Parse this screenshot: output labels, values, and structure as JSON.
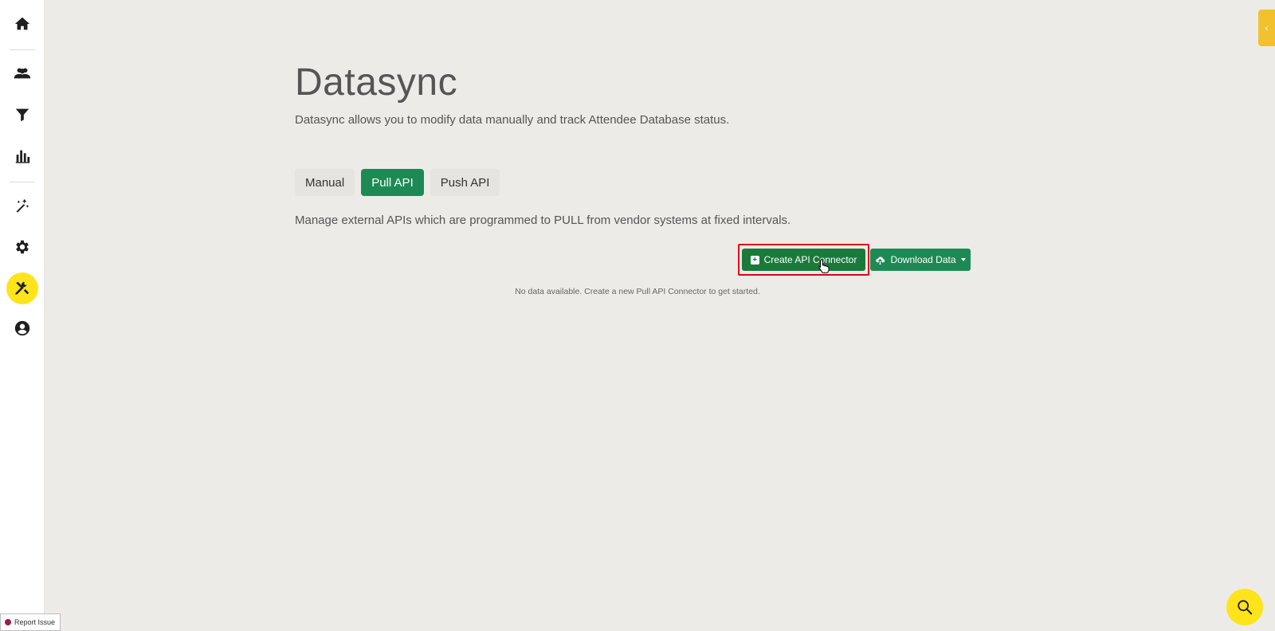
{
  "sidebar": {
    "items": [
      {
        "name": "home-icon"
      },
      {
        "name": "users-icon"
      },
      {
        "name": "filter-icon"
      },
      {
        "name": "bar-chart-icon"
      },
      {
        "name": "magic-wand-icon"
      },
      {
        "name": "gear-icon"
      },
      {
        "name": "tools-icon",
        "active": true
      },
      {
        "name": "account-circle-icon"
      }
    ]
  },
  "page": {
    "title": "Datasync",
    "subtitle": "Datasync allows you to modify data manually and track Attendee Database status."
  },
  "tabs": [
    {
      "label": "Manual"
    },
    {
      "label": "Pull API",
      "active": true
    },
    {
      "label": "Push API"
    }
  ],
  "tab_description": "Manage external APIs which are programmed to PULL from vendor systems at fixed intervals.",
  "actions": {
    "create_label": "Create API Connector",
    "download_label": "Download Data"
  },
  "empty_message": "No data available. Create a new Pull API Connector to get started.",
  "report_issue_label": "Report Issue",
  "colors": {
    "primary_green": "#1a7a3c",
    "active_tab_green": "#1d8a55",
    "accent_yellow": "#ffe41c",
    "highlight_red": "#e3001b"
  }
}
